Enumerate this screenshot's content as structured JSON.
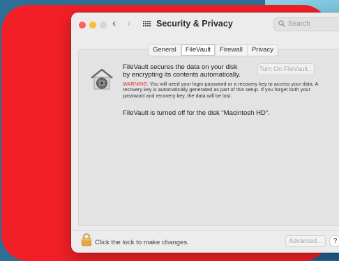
{
  "colors": {
    "red_panel": "#f21f26",
    "window_bg": "#ececec",
    "warning_red": "#e0352b"
  },
  "window": {
    "title": "Security & Privacy",
    "search_placeholder": "Search"
  },
  "tabs": [
    {
      "label": "General",
      "active": false
    },
    {
      "label": "FileVault",
      "active": true
    },
    {
      "label": "Firewall",
      "active": false
    },
    {
      "label": "Privacy",
      "active": false
    }
  ],
  "filevault": {
    "description": "FileVault secures the data on your disk by encrypting its contents automatically.",
    "turn_on_button": "Turn On FileVault...",
    "warning_label": "WARNING:",
    "warning_text": " You will need your login password or a recovery key to access your data. A recovery key is automatically generated as part of this setup. If you forget both your password and recovery key, the data will be lost.",
    "status": "FileVault is turned off for the disk “Macintosh HD”."
  },
  "footer": {
    "lock_text": "Click the lock to make changes.",
    "advanced_button": "Advanced...",
    "help_button": "?"
  },
  "icons": {
    "back": "chevron-left-icon",
    "forward": "chevron-right-icon",
    "grid": "grid-icon",
    "search": "search-icon",
    "filevault": "filevault-house-icon",
    "lock": "lock-icon"
  }
}
